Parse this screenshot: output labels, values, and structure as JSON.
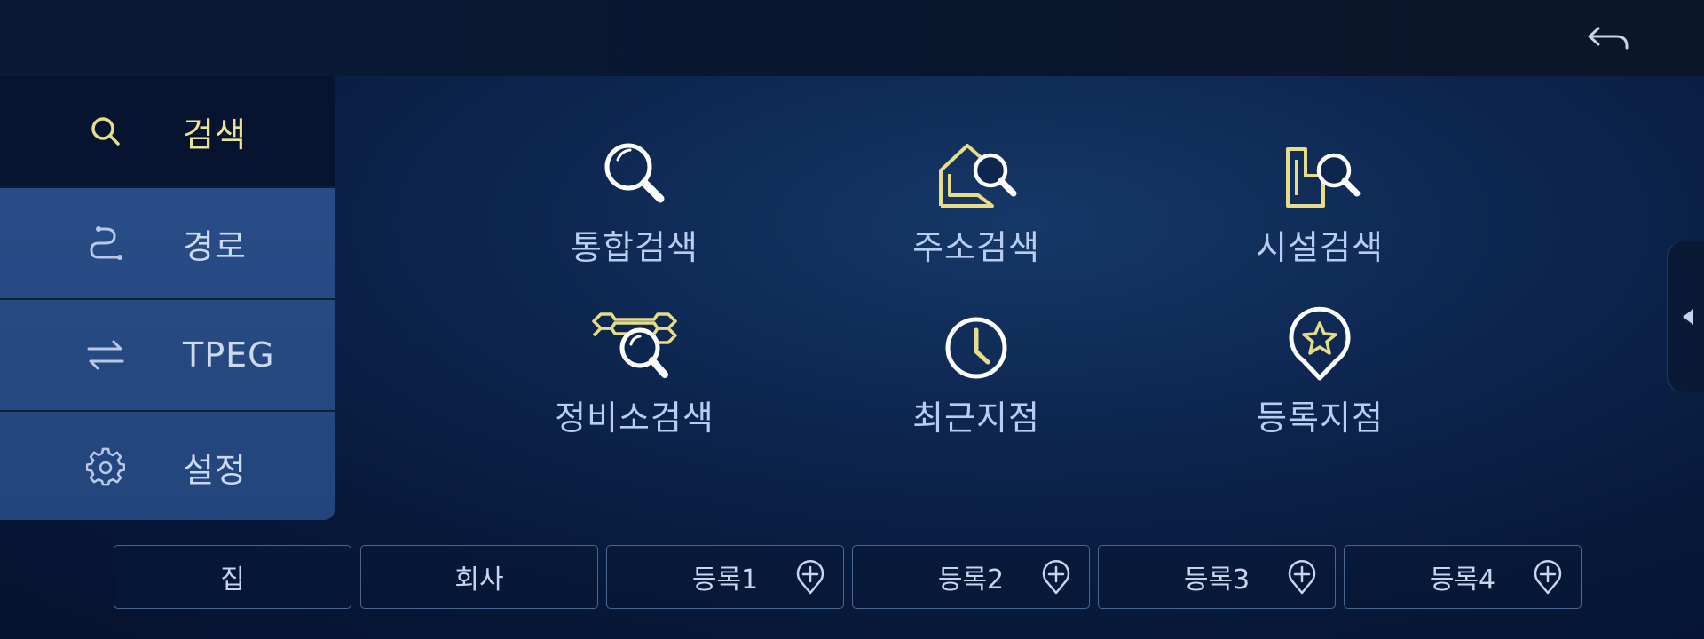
{
  "topbar": {
    "back_icon": "back-arrow-icon"
  },
  "sidebar": {
    "items": [
      {
        "label": "검색",
        "icon": "search-icon",
        "active": true
      },
      {
        "label": "경로",
        "icon": "route-icon",
        "active": false
      },
      {
        "label": "TPEG",
        "icon": "swap-arrows-icon",
        "active": false
      },
      {
        "label": "설정",
        "icon": "gear-icon",
        "active": false
      }
    ]
  },
  "grid": {
    "tiles": [
      {
        "label": "통합검색",
        "icon": "magnifier-icon"
      },
      {
        "label": "주소검색",
        "icon": "house-search-icon"
      },
      {
        "label": "시설검색",
        "icon": "building-search-icon"
      },
      {
        "label": "정비소검색",
        "icon": "wrench-search-icon"
      },
      {
        "label": "최근지점",
        "icon": "clock-icon"
      },
      {
        "label": "등록지점",
        "icon": "star-pin-icon"
      }
    ]
  },
  "quickbar": {
    "buttons": [
      {
        "label": "집",
        "has_add": false
      },
      {
        "label": "회사",
        "has_add": false
      },
      {
        "label": "등록1",
        "has_add": true,
        "add_icon": "pin-plus-icon"
      },
      {
        "label": "등록2",
        "has_add": true,
        "add_icon": "pin-plus-icon"
      },
      {
        "label": "등록3",
        "has_add": true,
        "add_icon": "pin-plus-icon"
      },
      {
        "label": "등록4",
        "has_add": true,
        "add_icon": "pin-plus-icon"
      }
    ]
  },
  "colors": {
    "accent_yellow": "#e6dc8a",
    "label_blue": "#b9cdf0",
    "active_bg": "#061430",
    "sidebar_bg": "#2b4f8a"
  }
}
